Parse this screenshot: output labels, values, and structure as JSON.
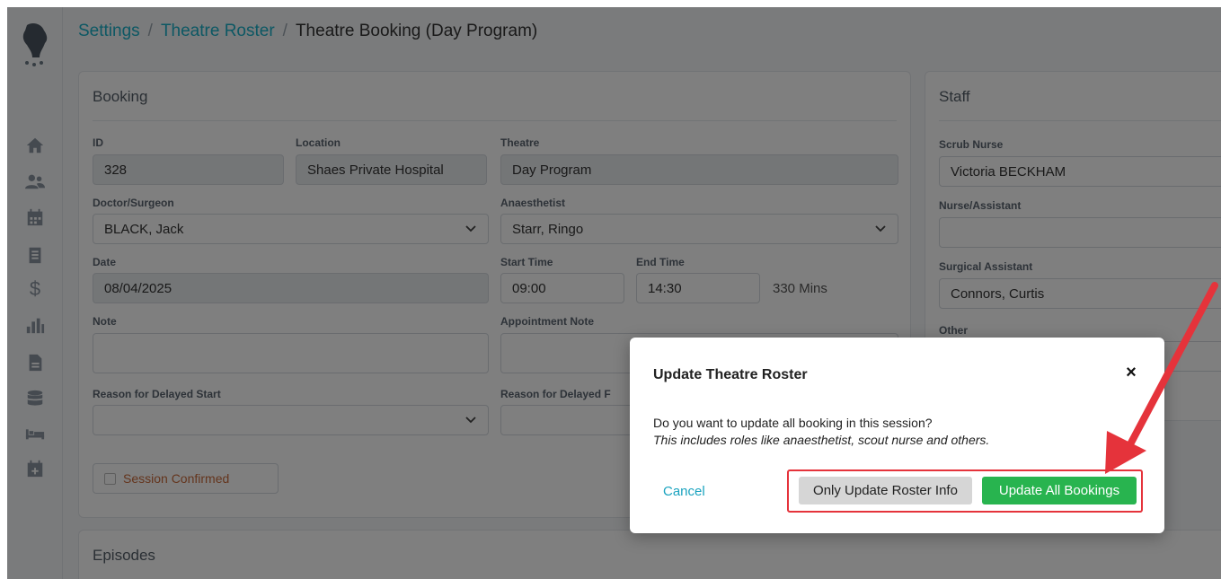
{
  "breadcrumb": {
    "settings": "Settings",
    "roster": "Theatre Roster",
    "current": "Theatre Booking (Day Program)",
    "separator": "/"
  },
  "booking": {
    "title": "Booking",
    "id_label": "ID",
    "id_value": "328",
    "location_label": "Location",
    "location_value": "Shaes Private Hospital",
    "theatre_label": "Theatre",
    "theatre_value": "Day Program",
    "doctor_label": "Doctor/Surgeon",
    "doctor_value": "BLACK, Jack",
    "anaesthetist_label": "Anaesthetist",
    "anaesthetist_value": "Starr, Ringo",
    "date_label": "Date",
    "date_value": "08/04/2025",
    "start_label": "Start Time",
    "start_value": "09:00",
    "end_label": "End Time",
    "end_value": "14:30",
    "duration": "330 Mins",
    "note_label": "Note",
    "appt_note_label": "Appointment Note",
    "delayed_start_label": "Reason for Delayed Start",
    "delayed_finish_label": "Reason for Delayed F",
    "session_confirmed": "Session Confirmed"
  },
  "staff": {
    "title": "Staff",
    "scrub_label": "Scrub Nurse",
    "scrub_value": "Victoria BECKHAM",
    "nurse_label": "Nurse/Assistant",
    "surgical_label": "Surgical Assistant",
    "surgical_value": "Connors, Curtis",
    "other_label": "Other"
  },
  "episodes": {
    "title": "Episodes"
  },
  "modal": {
    "title": "Update Theatre Roster",
    "close": "×",
    "body_line1": "Do you want to update all booking in this session?",
    "body_line2": "This includes roles like anaesthetist, scout nurse and others.",
    "cancel": "Cancel",
    "roster_only": "Only Update Roster Info",
    "update_all": "Update All Bookings"
  },
  "colors": {
    "accent": "#1ab0c8",
    "primary_green": "#28b44f",
    "highlight_red": "#e5333b"
  },
  "icons": [
    "dog-logo-icon",
    "home-icon",
    "users-icon",
    "calendar-icon",
    "clipboard-icon",
    "dollar-icon",
    "bar-chart-icon",
    "document-icon",
    "database-icon",
    "bed-icon",
    "calendar-add-icon"
  ]
}
